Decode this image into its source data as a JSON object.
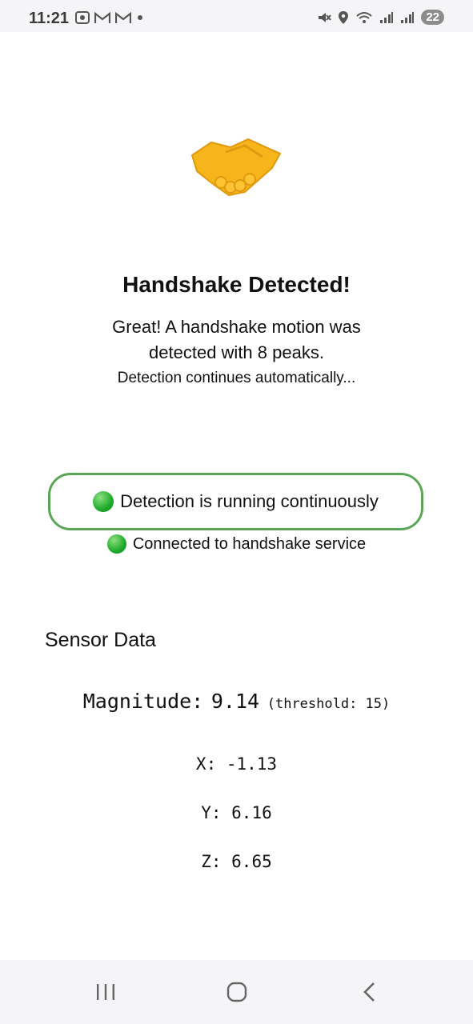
{
  "status_bar": {
    "time": "11:21",
    "notification_icons": [
      "screenshot-icon",
      "gmail-icon",
      "gmail-icon",
      "dot-icon"
    ],
    "system_icons": [
      "mute-icon",
      "location-icon",
      "wifi-icon",
      "signal-icon",
      "signal-icon"
    ],
    "battery": "22"
  },
  "main": {
    "emoji": "handshake-emoji",
    "title": "Handshake Detected!",
    "description": "Great! A handshake motion was detected with 8 peaks.",
    "note": "Detection continues automatically...",
    "running_status": "Detection is running continuously",
    "connection_status": "Connected to handshake service",
    "status_color": "#5aa656"
  },
  "sensor": {
    "heading": "Sensor Data",
    "magnitude_label": "Magnitude:",
    "magnitude_value": "9.14",
    "threshold_text": "(threshold: 15)",
    "x": "X: -1.13",
    "y": "Y: 6.16",
    "z": "Z: 6.65"
  },
  "nav": {
    "buttons": [
      "recent-apps-icon",
      "home-icon",
      "back-icon"
    ]
  }
}
